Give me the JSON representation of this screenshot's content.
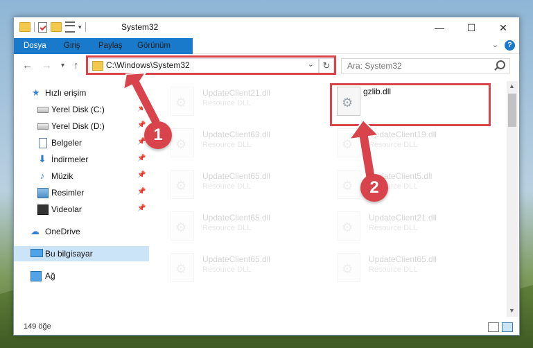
{
  "window": {
    "title": "System32",
    "minimize": "—",
    "maximize": "☐",
    "close": "✕"
  },
  "ribbon": {
    "tabs": [
      "Dosya",
      "Giriş",
      "Paylaş",
      "Görünüm"
    ]
  },
  "nav": {
    "back": "←",
    "forward": "→",
    "recent": "▾",
    "up": "↑",
    "address": "C:\\Windows\\System32",
    "refresh": "↻",
    "search_placeholder": "Ara: System32"
  },
  "sidebar": {
    "items": [
      {
        "label": "Hızlı erişim",
        "icon": "star-icon"
      },
      {
        "label": "Yerel Disk (C:)",
        "icon": "drive-icon",
        "pinned": true
      },
      {
        "label": "Yerel Disk (D:)",
        "icon": "drive-icon",
        "pinned": true
      },
      {
        "label": "Belgeler",
        "icon": "documents-icon",
        "pinned": true
      },
      {
        "label": "İndirmeler",
        "icon": "downloads-icon",
        "pinned": true
      },
      {
        "label": "Müzik",
        "icon": "music-icon",
        "pinned": true
      },
      {
        "label": "Resimler",
        "icon": "pictures-icon",
        "pinned": true
      },
      {
        "label": "Videolar",
        "icon": "videos-icon",
        "pinned": true
      },
      {
        "label": "OneDrive",
        "icon": "cloud-icon"
      },
      {
        "label": "Bu bilgisayar",
        "icon": "computer-icon",
        "selected": true
      },
      {
        "label": "Ağ",
        "icon": "network-icon"
      }
    ]
  },
  "files": [
    {
      "name": "UpdateClient21.dll",
      "type": "Resource DLL"
    },
    {
      "name": "gzlib.dll",
      "type": ""
    },
    {
      "name": "UpdateClient63.dll",
      "type": "Resource DLL"
    },
    {
      "name": "UpdateClient19.dll",
      "type": "Resource DLL"
    },
    {
      "name": "UpdateClient65.dll",
      "type": "Resource DLL"
    },
    {
      "name": "UpdateClient5.dll",
      "type": "Resource DLL"
    },
    {
      "name": "UpdateClient65.dll",
      "type": "Resource DLL"
    },
    {
      "name": "UpdateClient21.dll",
      "type": "Resource DLL"
    },
    {
      "name": "UpdateClient65.dll",
      "type": "Resource DLL"
    },
    {
      "name": "UpdateClient65.dll",
      "type": "Resource DLL"
    }
  ],
  "status": {
    "count": "149 öğe"
  },
  "annotations": {
    "step1": "1",
    "step2": "2",
    "color": "#d9434b"
  }
}
